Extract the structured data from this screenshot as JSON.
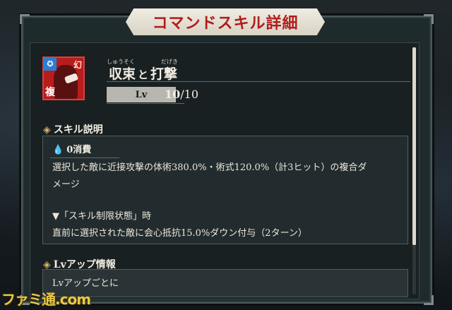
{
  "header": {
    "title": "コマンドスキル詳細"
  },
  "skill": {
    "icon_badge": "✪",
    "icon_tag": "幻",
    "icon_bottom": "複",
    "ruby_1": "しゅうそく",
    "ruby_2": "だげき",
    "name_part1": "収束",
    "name_connector": "と",
    "name_part2": "打撃",
    "lv_label": "Lv",
    "lv_current": "10",
    "lv_max": "/10"
  },
  "description": {
    "section_title": "スキル説明",
    "cost": "0消費",
    "line1": "選択した敵に近接攻撃の体術380.0%・術式120.0%（計3ヒット）の複合ダ",
    "line2": "メージ",
    "line3": "▼「スキル制限状態」時",
    "line4": "直前に選択された敵に会心抵抗15.0%ダウン付与（2ターン）"
  },
  "lvup": {
    "section_title": "Lvアップ情報",
    "text": "Lvアップごとに"
  },
  "watermark": "ファミ通.com",
  "colors": {
    "accent_red": "#b01c1c",
    "panel": "#182022",
    "banner": "#f0ece2"
  }
}
